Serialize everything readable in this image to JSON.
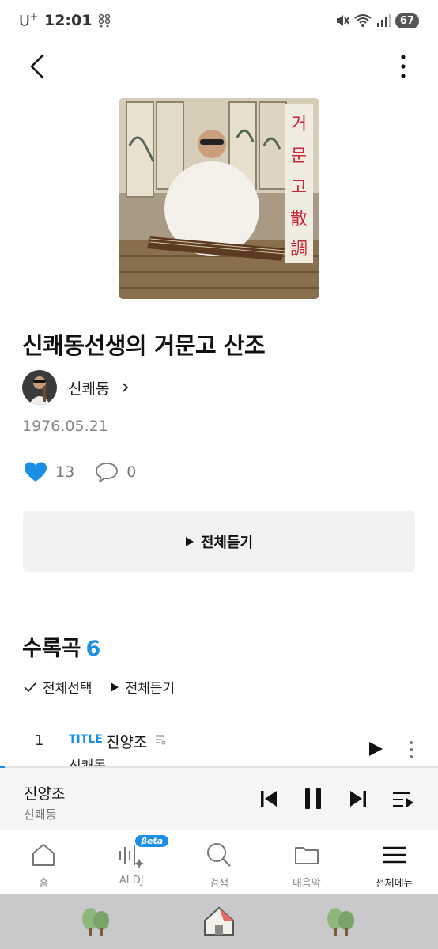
{
  "status_bar": {
    "carrier": "U",
    "carrier_sup": "+",
    "time": "12:01",
    "battery": "67"
  },
  "icons": {
    "back": "back-arrow-icon",
    "more": "more-vertical-icon",
    "heart": "heart-icon",
    "comment": "comment-icon",
    "play": "play-icon",
    "check": "check-icon"
  },
  "album": {
    "title": "신쾌동선생의 거문고 산조",
    "artist": "신쾌동",
    "release_date": "1976.05.21",
    "likes": "13",
    "comments": "0",
    "cover_text": "거문고散調"
  },
  "actions": {
    "play_all": "전체듣기"
  },
  "tracklist": {
    "heading": "수록곡",
    "count": "6",
    "select_all": "전체선택",
    "play_all": "전체듣기",
    "tracks": [
      {
        "number": "1",
        "badge": "TITLE",
        "title": "진양조",
        "artist": "신쾌동"
      }
    ]
  },
  "mini_player": {
    "title": "진양조",
    "artist": "신쾌동"
  },
  "bottom_nav": {
    "items": [
      {
        "label": "홈",
        "icon": "home-icon"
      },
      {
        "label": "AI DJ",
        "icon": "ai-dj-icon",
        "badge": "βeta"
      },
      {
        "label": "검색",
        "icon": "search-icon"
      },
      {
        "label": "내음악",
        "icon": "folder-icon"
      },
      {
        "label": "전체메뉴",
        "icon": "menu-icon"
      }
    ]
  },
  "colors": {
    "accent": "#1a8fe3",
    "heart": "#1a8fe3",
    "button_bg": "#f2f2f4",
    "launcher_bg": "#c9c9cb"
  }
}
